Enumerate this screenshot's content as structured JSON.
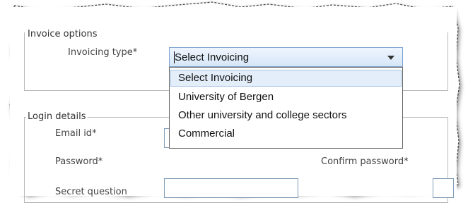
{
  "invoice": {
    "legend": "Invoice options",
    "type_label": "Invoicing type*",
    "selected": "Select Invoicing",
    "options": [
      "Select Invoicing",
      "University of Bergen",
      "Other university and college sectors",
      "Commercial"
    ]
  },
  "login": {
    "legend": "Login details",
    "email_label": "Email id*",
    "password_label": "Password*",
    "confirm_label": "Confirm password*",
    "question_label": "Secret question"
  }
}
